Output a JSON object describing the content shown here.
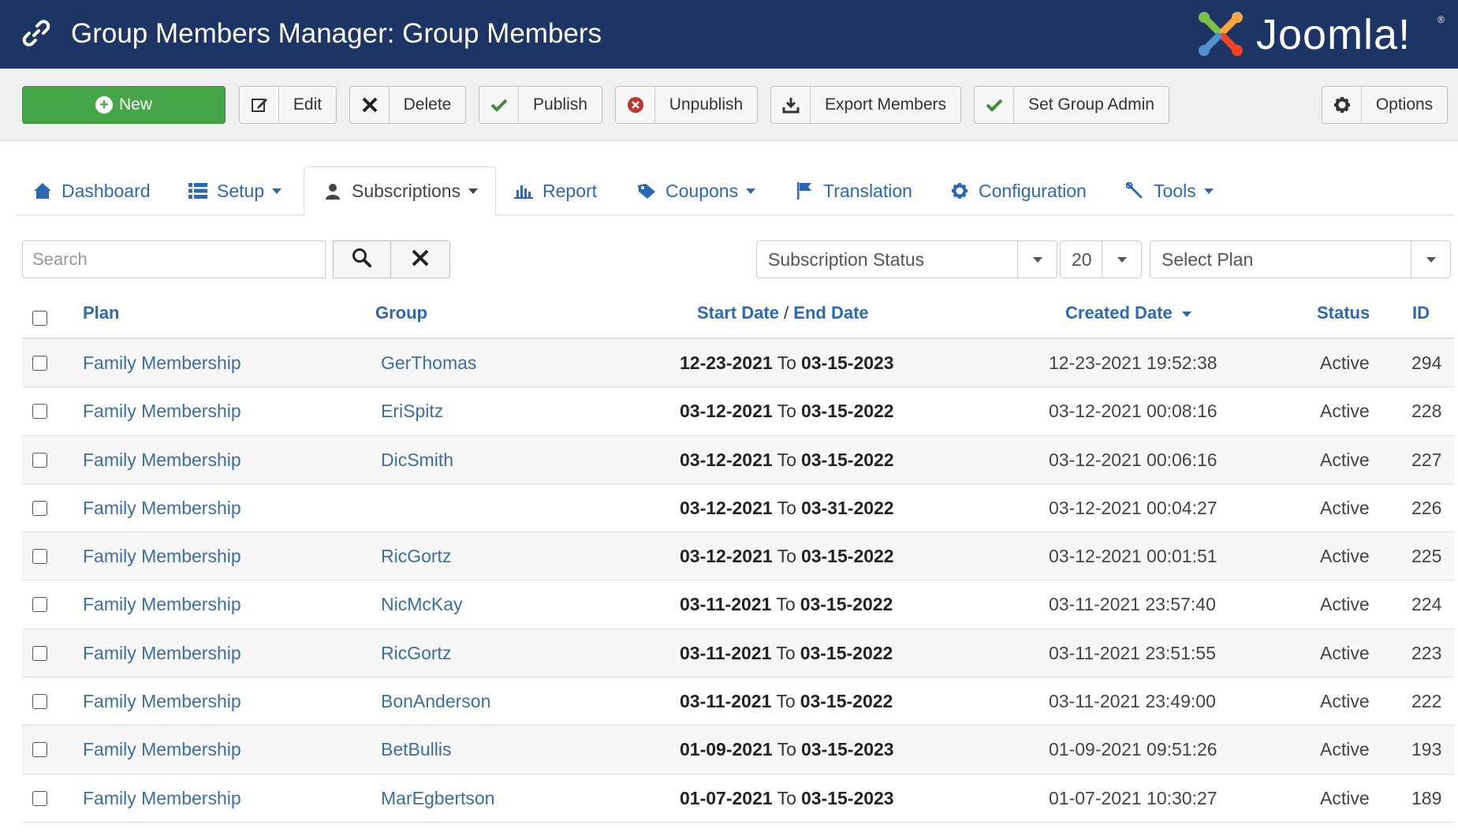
{
  "header": {
    "title": "Group Members Manager: Group Members",
    "logo_text": "Joomla!",
    "logo_reg": "®"
  },
  "toolbar": {
    "new_label": "New",
    "edit_label": "Edit",
    "delete_label": "Delete",
    "publish_label": "Publish",
    "unpublish_label": "Unpublish",
    "export_label": "Export Members",
    "set_admin_label": "Set Group Admin",
    "options_label": "Options"
  },
  "tabs": {
    "dashboard": "Dashboard",
    "setup": "Setup",
    "subscriptions": "Subscriptions",
    "report": "Report",
    "coupons": "Coupons",
    "translation": "Translation",
    "configuration": "Configuration",
    "tools": "Tools"
  },
  "filters": {
    "search_placeholder": "Search",
    "status": "Subscription Status",
    "limit": "20",
    "plan": "Select Plan"
  },
  "table": {
    "headers": {
      "plan": "Plan",
      "group": "Group",
      "start_date": "Start Date",
      "date_sep": "/",
      "end_date": "End Date",
      "created": "Created Date",
      "status": "Status",
      "id": "ID"
    },
    "to_label": "To",
    "rows": [
      {
        "plan": "Family Membership",
        "group": "GerThomas",
        "start": "12-23-2021",
        "end": "03-15-2023",
        "created": "12-23-2021 19:52:38",
        "status": "Active",
        "id": "294"
      },
      {
        "plan": "Family Membership",
        "group": "EriSpitz",
        "start": "03-12-2021",
        "end": "03-15-2022",
        "created": "03-12-2021 00:08:16",
        "status": "Active",
        "id": "228"
      },
      {
        "plan": "Family Membership",
        "group": "DicSmith",
        "start": "03-12-2021",
        "end": "03-15-2022",
        "created": "03-12-2021 00:06:16",
        "status": "Active",
        "id": "227"
      },
      {
        "plan": "Family Membership",
        "group": "",
        "start": "03-12-2021",
        "end": "03-31-2022",
        "created": "03-12-2021 00:04:27",
        "status": "Active",
        "id": "226"
      },
      {
        "plan": "Family Membership",
        "group": "RicGortz",
        "start": "03-12-2021",
        "end": "03-15-2022",
        "created": "03-12-2021 00:01:51",
        "status": "Active",
        "id": "225"
      },
      {
        "plan": "Family Membership",
        "group": "NicMcKay",
        "start": "03-11-2021",
        "end": "03-15-2022",
        "created": "03-11-2021 23:57:40",
        "status": "Active",
        "id": "224"
      },
      {
        "plan": "Family Membership",
        "group": "RicGortz",
        "start": "03-11-2021",
        "end": "03-15-2022",
        "created": "03-11-2021 23:51:55",
        "status": "Active",
        "id": "223"
      },
      {
        "plan": "Family Membership",
        "group": "BonAnderson",
        "start": "03-11-2021",
        "end": "03-15-2022",
        "created": "03-11-2021 23:49:00",
        "status": "Active",
        "id": "222"
      },
      {
        "plan": "Family Membership",
        "group": "BetBullis",
        "start": "01-09-2021",
        "end": "03-15-2023",
        "created": "01-09-2021 09:51:26",
        "status": "Active",
        "id": "193"
      },
      {
        "plan": "Family Membership",
        "group": "MarEgbertson",
        "start": "01-07-2021",
        "end": "03-15-2023",
        "created": "01-07-2021 10:30:27",
        "status": "Active",
        "id": "189"
      }
    ]
  },
  "colors": {
    "header_bg": "#1c3564",
    "link": "#2a69b8",
    "new_button": "#46a546",
    "check_green": "#3c8d3c",
    "unpublish_red": "#bd362f"
  }
}
